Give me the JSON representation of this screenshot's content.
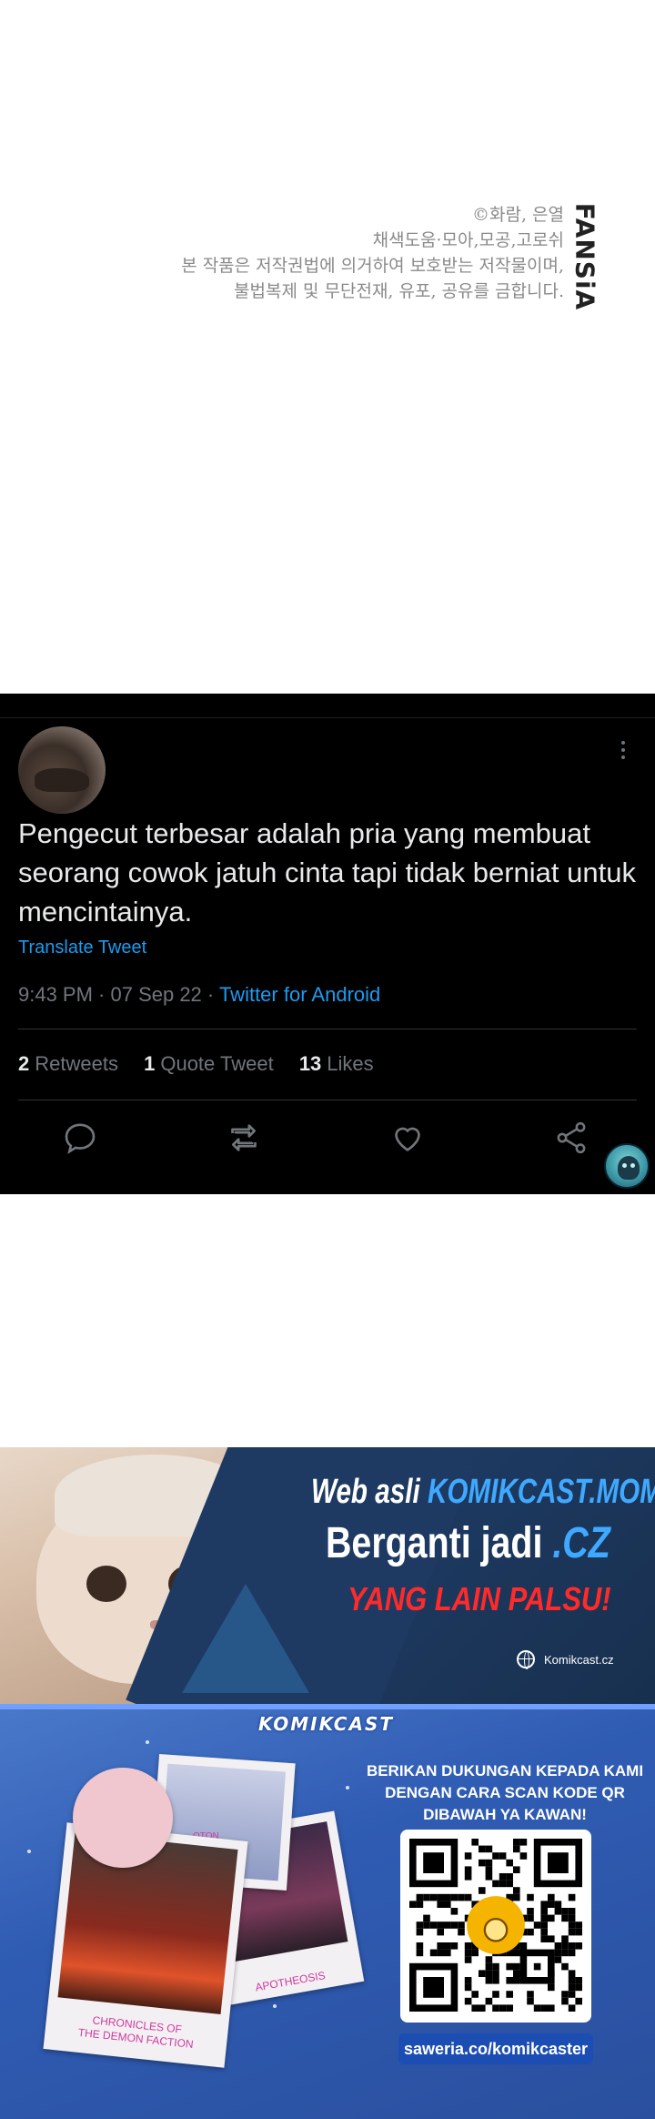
{
  "credits": {
    "brand": "FANSiA",
    "lines": [
      "©화람, 은열",
      "채색도움·모아,모공,고로쉬",
      "본 작품은 저작권법에 의거하여 보호받는 저작물이며,",
      "불법복제 및 무단전재, 유포, 공유를 금합니다."
    ]
  },
  "tweet": {
    "text": "Pengecut terbesar adalah pria yang membuat seorang cowok jatuh cinta tapi tidak berniat untuk mencintainya.",
    "translate": "Translate Tweet",
    "time": "9:43 PM · 07 Sep 22 · ",
    "client": "Twitter for Android",
    "stats": {
      "retweets_count": "2",
      "retweets_label": "Retweets",
      "quotes_count": "1",
      "quotes_label": "Quote Tweet",
      "likes_count": "13",
      "likes_label": "Likes"
    },
    "icons": [
      "reply-icon",
      "retweet-icon",
      "like-icon",
      "share-icon"
    ],
    "colors": {
      "background": "#000000",
      "link": "#1d9bf0",
      "muted": "#71767b",
      "text": "#e7e9ea"
    }
  },
  "banner1": {
    "line1_prefix": "Web asli ",
    "line1_highlight": "KOMIKCAST.MOM",
    "line2_prefix": "Berganti jadi ",
    "line2_highlight": ".CZ",
    "line3": "YANG LAIN PALSU!",
    "site": "Komikcast.cz",
    "colors": {
      "highlight": "#3fa9ff",
      "warning": "#ff2a2a"
    }
  },
  "banner2": {
    "logo": "KOMIKCAST",
    "support_lines": [
      "BERIKAN DUKUNGAN KEPADA KAMI",
      "DENGAN CARA SCAN KODE QR",
      "DIBAWAH YA KAWAN!"
    ],
    "saweria": "saweria.co/komikcaster",
    "polaroid_left": [
      "CHRONICLES OF",
      "THE DEMON FACTION"
    ],
    "polaroid_right": "APOTHEOSIS",
    "polaroid_top": "OTON"
  }
}
